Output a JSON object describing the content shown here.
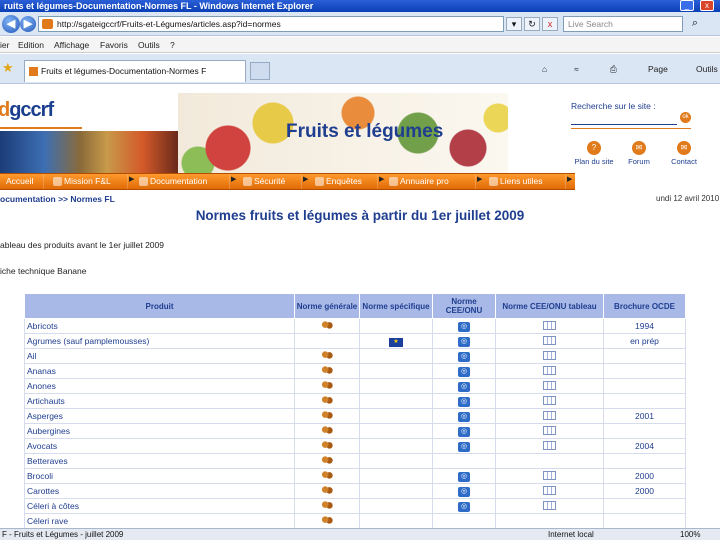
{
  "window": {
    "title": "ruits et légumes-Documentation-Normes FL - Windows Internet Explorer",
    "minimize": "_",
    "close": "x"
  },
  "address": {
    "back": "◀",
    "forward": "▶",
    "url": "http://sgateigccrf/Fruits-et-Légumes/articles.asp?id=normes",
    "refresh": "↻",
    "stop": "x",
    "search_placeholder": "Live Search",
    "search_go": "⌕"
  },
  "menu": {
    "items": [
      "ier",
      "Edition",
      "Affichage",
      "Favoris",
      "Outils",
      "?"
    ]
  },
  "tabs": {
    "active": "Fruits et légumes-Documentation-Normes F",
    "home": "⌂",
    "feeds": "≈",
    "print": "⎙",
    "page": "Page",
    "tools": "Outils"
  },
  "site": {
    "logo_prefix": "d",
    "logo_main": "gccrf",
    "title": "Fruits et légumes",
    "search_label": "Recherche sur le site :",
    "search_ok": "ok",
    "quick_links": [
      {
        "label": "Plan du site",
        "icon": "?"
      },
      {
        "label": "Forum",
        "icon": "✉"
      },
      {
        "label": "Contact",
        "icon": "✉"
      }
    ]
  },
  "nav": [
    {
      "label": "Accueil"
    },
    {
      "label": "Mission F&L"
    },
    {
      "label": "Documentation"
    },
    {
      "label": "Sécurité"
    },
    {
      "label": "Enquêtes"
    },
    {
      "label": "Annuaire pro"
    },
    {
      "label": "Liens utiles"
    }
  ],
  "breadcrumb": "ocumentation >> Normes FL",
  "date": "undi 12 avril 2010",
  "heading": "Normes fruits et légumes à partir du 1er juillet 2009",
  "line1": "ableau des produits avant le 1er juillet 2009",
  "line2": "iche technique Banane",
  "table": {
    "headers": [
      "Produit",
      "Norme générale",
      "Norme spécifique",
      "Norme CEE/ONU",
      "Norme CEE/ONU tableau",
      "Brochure OCDE"
    ],
    "rows": [
      {
        "product": "Abricots",
        "gen": true,
        "spec": "",
        "unece": true,
        "tab": true,
        "ocde": "1994"
      },
      {
        "product": "Agrumes (sauf pamplemousses)",
        "gen": false,
        "spec": "eu",
        "unece": true,
        "tab": true,
        "ocde": "en prép"
      },
      {
        "product": "Ail",
        "gen": true,
        "spec": "",
        "unece": true,
        "tab": true,
        "ocde": ""
      },
      {
        "product": "Ananas",
        "gen": true,
        "spec": "",
        "unece": true,
        "tab": true,
        "ocde": ""
      },
      {
        "product": "Anones",
        "gen": true,
        "spec": "",
        "unece": true,
        "tab": true,
        "ocde": ""
      },
      {
        "product": "Artichauts",
        "gen": true,
        "spec": "",
        "unece": true,
        "tab": true,
        "ocde": ""
      },
      {
        "product": "Asperges",
        "gen": true,
        "spec": "",
        "unece": true,
        "tab": true,
        "ocde": "2001"
      },
      {
        "product": "Aubergines",
        "gen": true,
        "spec": "",
        "unece": true,
        "tab": true,
        "ocde": ""
      },
      {
        "product": "Avocats",
        "gen": true,
        "spec": "",
        "unece": true,
        "tab": true,
        "ocde": "2004"
      },
      {
        "product": "Betteraves",
        "gen": true,
        "spec": "",
        "unece": false,
        "tab": false,
        "ocde": ""
      },
      {
        "product": "Brocoli",
        "gen": true,
        "spec": "",
        "unece": true,
        "tab": true,
        "ocde": "2000"
      },
      {
        "product": "Carottes",
        "gen": true,
        "spec": "",
        "unece": true,
        "tab": true,
        "ocde": "2000"
      },
      {
        "product": "Céleri à côtes",
        "gen": true,
        "spec": "",
        "unece": true,
        "tab": true,
        "ocde": ""
      },
      {
        "product": "Céleri rave",
        "gen": true,
        "spec": "",
        "unece": false,
        "tab": false,
        "ocde": ""
      }
    ]
  },
  "status": {
    "text": "F - Fruits et Légumes - juillet 2009",
    "zone": "Internet local",
    "zoom": "100%"
  }
}
